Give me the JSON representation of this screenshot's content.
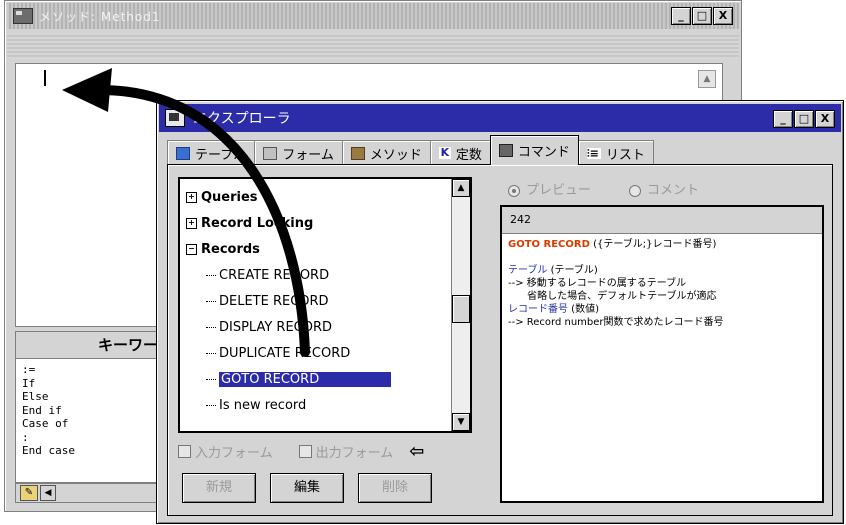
{
  "back_window": {
    "title": "メソッド: Method1",
    "buttons": [
      "_",
      "□",
      "X"
    ],
    "keyword_panel": {
      "header": "キーワー",
      "items": [
        ":=",
        "If",
        "Else",
        "End if",
        "Case of",
        ":",
        "End case"
      ]
    }
  },
  "explorer": {
    "title": "エクスプローラ",
    "buttons": [
      "_",
      "□",
      "X"
    ],
    "tabs": [
      {
        "label": "テーブル",
        "icon": "table-icon"
      },
      {
        "label": "フォーム",
        "icon": "form-icon"
      },
      {
        "label": "メソッド",
        "icon": "method-icon"
      },
      {
        "label": "定数",
        "icon": "constant-icon"
      },
      {
        "label": "コマンド",
        "icon": "command-icon",
        "active": true
      },
      {
        "label": "リスト",
        "icon": "list-icon"
      }
    ],
    "tree": {
      "categories": [
        "Queries",
        "Record Locking",
        "Records"
      ],
      "commands": [
        "CREATE RECORD",
        "DELETE RECORD",
        "DISPLAY RECORD",
        "DUPLICATE RECORD",
        "GOTO RECORD",
        "Is new record"
      ],
      "selected": "GOTO RECORD"
    },
    "checkboxes": [
      "入力フォーム",
      "出力フォーム"
    ],
    "action_buttons": [
      "新規",
      "編集",
      "削除"
    ],
    "radio_options": [
      "プレビュー",
      "コメント"
    ],
    "preview": {
      "number": "242",
      "syntax_cmd": "GOTO RECORD",
      "syntax_rest": " ({テーブル;}レコード番号)",
      "param1_name": "テーブル",
      "param1_type": " (テーブル)",
      "param1_desc1": "--> 移動するレコードの属するテーブル",
      "param1_desc2": "      省略した場合、デフォルトテーブルが適応",
      "param2_name": "レコード番号",
      "param2_type": " (数値)",
      "param2_desc": "--> Record number関数で求めたレコード番号"
    }
  },
  "colors": {
    "title_active": "#2c2ca8",
    "selection": "#2c2ca8",
    "syntax_red": "#d83a00",
    "syntax_blue": "#2233aa"
  }
}
